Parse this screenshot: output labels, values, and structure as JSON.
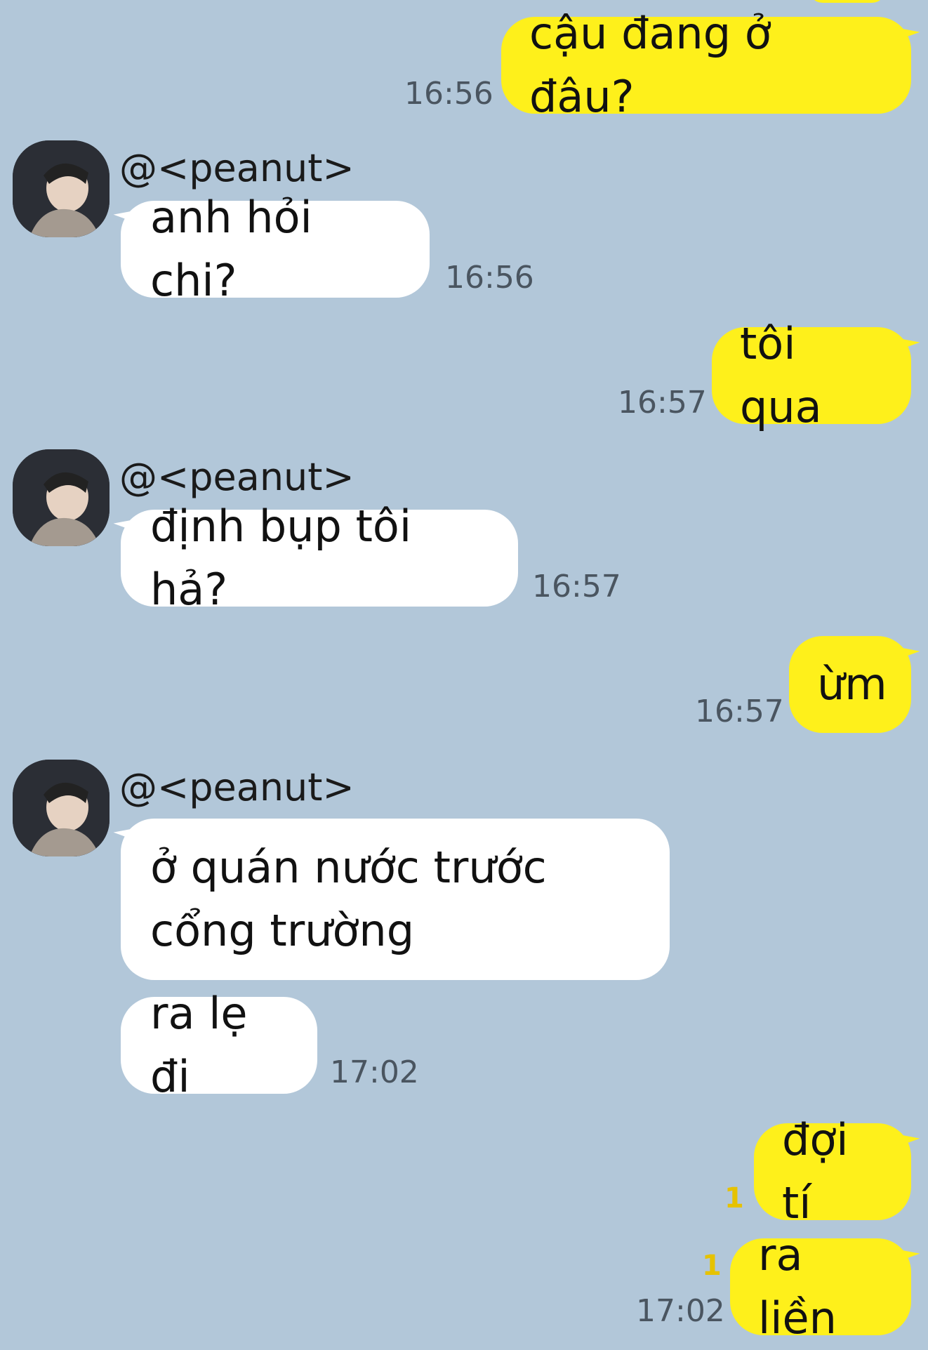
{
  "contact": {
    "name": "@<peanut>"
  },
  "colors": {
    "background": "#b2c7d9",
    "outgoing_bubble": "#fef01b",
    "incoming_bubble": "#ffffff",
    "unread": "#e6c200"
  },
  "messages": [
    {
      "direction": "out",
      "text": "cậu đang ở đâu?",
      "time": "16:56"
    },
    {
      "direction": "in",
      "text": "anh hỏi chi?",
      "time": "16:56"
    },
    {
      "direction": "out",
      "text": "tôi qua",
      "time": "16:57"
    },
    {
      "direction": "in",
      "text": "định bụp tôi hả?",
      "time": "16:57"
    },
    {
      "direction": "out",
      "text": "ừm",
      "time": "16:57"
    },
    {
      "direction": "in",
      "text": "ở quán nước trước\ncổng trường"
    },
    {
      "direction": "in",
      "text": "ra lẹ đi",
      "time": "17:02"
    },
    {
      "direction": "out",
      "text": "đợi tí",
      "unread": "1"
    },
    {
      "direction": "out",
      "text": "ra liền",
      "unread": "1",
      "time": "17:02"
    }
  ]
}
